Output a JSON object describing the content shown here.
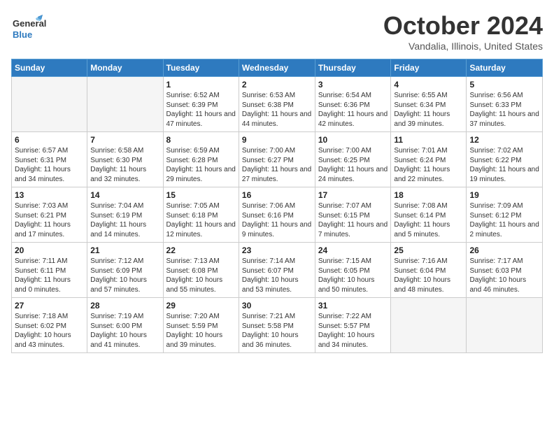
{
  "header": {
    "logo_line1": "General",
    "logo_line2": "Blue",
    "month": "October 2024",
    "location": "Vandalia, Illinois, United States"
  },
  "days_of_week": [
    "Sunday",
    "Monday",
    "Tuesday",
    "Wednesday",
    "Thursday",
    "Friday",
    "Saturday"
  ],
  "weeks": [
    [
      {
        "num": "",
        "sunrise": "",
        "sunset": "",
        "daylight": ""
      },
      {
        "num": "",
        "sunrise": "",
        "sunset": "",
        "daylight": ""
      },
      {
        "num": "1",
        "sunrise": "Sunrise: 6:52 AM",
        "sunset": "Sunset: 6:39 PM",
        "daylight": "Daylight: 11 hours and 47 minutes."
      },
      {
        "num": "2",
        "sunrise": "Sunrise: 6:53 AM",
        "sunset": "Sunset: 6:38 PM",
        "daylight": "Daylight: 11 hours and 44 minutes."
      },
      {
        "num": "3",
        "sunrise": "Sunrise: 6:54 AM",
        "sunset": "Sunset: 6:36 PM",
        "daylight": "Daylight: 11 hours and 42 minutes."
      },
      {
        "num": "4",
        "sunrise": "Sunrise: 6:55 AM",
        "sunset": "Sunset: 6:34 PM",
        "daylight": "Daylight: 11 hours and 39 minutes."
      },
      {
        "num": "5",
        "sunrise": "Sunrise: 6:56 AM",
        "sunset": "Sunset: 6:33 PM",
        "daylight": "Daylight: 11 hours and 37 minutes."
      }
    ],
    [
      {
        "num": "6",
        "sunrise": "Sunrise: 6:57 AM",
        "sunset": "Sunset: 6:31 PM",
        "daylight": "Daylight: 11 hours and 34 minutes."
      },
      {
        "num": "7",
        "sunrise": "Sunrise: 6:58 AM",
        "sunset": "Sunset: 6:30 PM",
        "daylight": "Daylight: 11 hours and 32 minutes."
      },
      {
        "num": "8",
        "sunrise": "Sunrise: 6:59 AM",
        "sunset": "Sunset: 6:28 PM",
        "daylight": "Daylight: 11 hours and 29 minutes."
      },
      {
        "num": "9",
        "sunrise": "Sunrise: 7:00 AM",
        "sunset": "Sunset: 6:27 PM",
        "daylight": "Daylight: 11 hours and 27 minutes."
      },
      {
        "num": "10",
        "sunrise": "Sunrise: 7:00 AM",
        "sunset": "Sunset: 6:25 PM",
        "daylight": "Daylight: 11 hours and 24 minutes."
      },
      {
        "num": "11",
        "sunrise": "Sunrise: 7:01 AM",
        "sunset": "Sunset: 6:24 PM",
        "daylight": "Daylight: 11 hours and 22 minutes."
      },
      {
        "num": "12",
        "sunrise": "Sunrise: 7:02 AM",
        "sunset": "Sunset: 6:22 PM",
        "daylight": "Daylight: 11 hours and 19 minutes."
      }
    ],
    [
      {
        "num": "13",
        "sunrise": "Sunrise: 7:03 AM",
        "sunset": "Sunset: 6:21 PM",
        "daylight": "Daylight: 11 hours and 17 minutes."
      },
      {
        "num": "14",
        "sunrise": "Sunrise: 7:04 AM",
        "sunset": "Sunset: 6:19 PM",
        "daylight": "Daylight: 11 hours and 14 minutes."
      },
      {
        "num": "15",
        "sunrise": "Sunrise: 7:05 AM",
        "sunset": "Sunset: 6:18 PM",
        "daylight": "Daylight: 11 hours and 12 minutes."
      },
      {
        "num": "16",
        "sunrise": "Sunrise: 7:06 AM",
        "sunset": "Sunset: 6:16 PM",
        "daylight": "Daylight: 11 hours and 9 minutes."
      },
      {
        "num": "17",
        "sunrise": "Sunrise: 7:07 AM",
        "sunset": "Sunset: 6:15 PM",
        "daylight": "Daylight: 11 hours and 7 minutes."
      },
      {
        "num": "18",
        "sunrise": "Sunrise: 7:08 AM",
        "sunset": "Sunset: 6:14 PM",
        "daylight": "Daylight: 11 hours and 5 minutes."
      },
      {
        "num": "19",
        "sunrise": "Sunrise: 7:09 AM",
        "sunset": "Sunset: 6:12 PM",
        "daylight": "Daylight: 11 hours and 2 minutes."
      }
    ],
    [
      {
        "num": "20",
        "sunrise": "Sunrise: 7:11 AM",
        "sunset": "Sunset: 6:11 PM",
        "daylight": "Daylight: 11 hours and 0 minutes."
      },
      {
        "num": "21",
        "sunrise": "Sunrise: 7:12 AM",
        "sunset": "Sunset: 6:09 PM",
        "daylight": "Daylight: 10 hours and 57 minutes."
      },
      {
        "num": "22",
        "sunrise": "Sunrise: 7:13 AM",
        "sunset": "Sunset: 6:08 PM",
        "daylight": "Daylight: 10 hours and 55 minutes."
      },
      {
        "num": "23",
        "sunrise": "Sunrise: 7:14 AM",
        "sunset": "Sunset: 6:07 PM",
        "daylight": "Daylight: 10 hours and 53 minutes."
      },
      {
        "num": "24",
        "sunrise": "Sunrise: 7:15 AM",
        "sunset": "Sunset: 6:05 PM",
        "daylight": "Daylight: 10 hours and 50 minutes."
      },
      {
        "num": "25",
        "sunrise": "Sunrise: 7:16 AM",
        "sunset": "Sunset: 6:04 PM",
        "daylight": "Daylight: 10 hours and 48 minutes."
      },
      {
        "num": "26",
        "sunrise": "Sunrise: 7:17 AM",
        "sunset": "Sunset: 6:03 PM",
        "daylight": "Daylight: 10 hours and 46 minutes."
      }
    ],
    [
      {
        "num": "27",
        "sunrise": "Sunrise: 7:18 AM",
        "sunset": "Sunset: 6:02 PM",
        "daylight": "Daylight: 10 hours and 43 minutes."
      },
      {
        "num": "28",
        "sunrise": "Sunrise: 7:19 AM",
        "sunset": "Sunset: 6:00 PM",
        "daylight": "Daylight: 10 hours and 41 minutes."
      },
      {
        "num": "29",
        "sunrise": "Sunrise: 7:20 AM",
        "sunset": "Sunset: 5:59 PM",
        "daylight": "Daylight: 10 hours and 39 minutes."
      },
      {
        "num": "30",
        "sunrise": "Sunrise: 7:21 AM",
        "sunset": "Sunset: 5:58 PM",
        "daylight": "Daylight: 10 hours and 36 minutes."
      },
      {
        "num": "31",
        "sunrise": "Sunrise: 7:22 AM",
        "sunset": "Sunset: 5:57 PM",
        "daylight": "Daylight: 10 hours and 34 minutes."
      },
      {
        "num": "",
        "sunrise": "",
        "sunset": "",
        "daylight": ""
      },
      {
        "num": "",
        "sunrise": "",
        "sunset": "",
        "daylight": ""
      }
    ]
  ]
}
